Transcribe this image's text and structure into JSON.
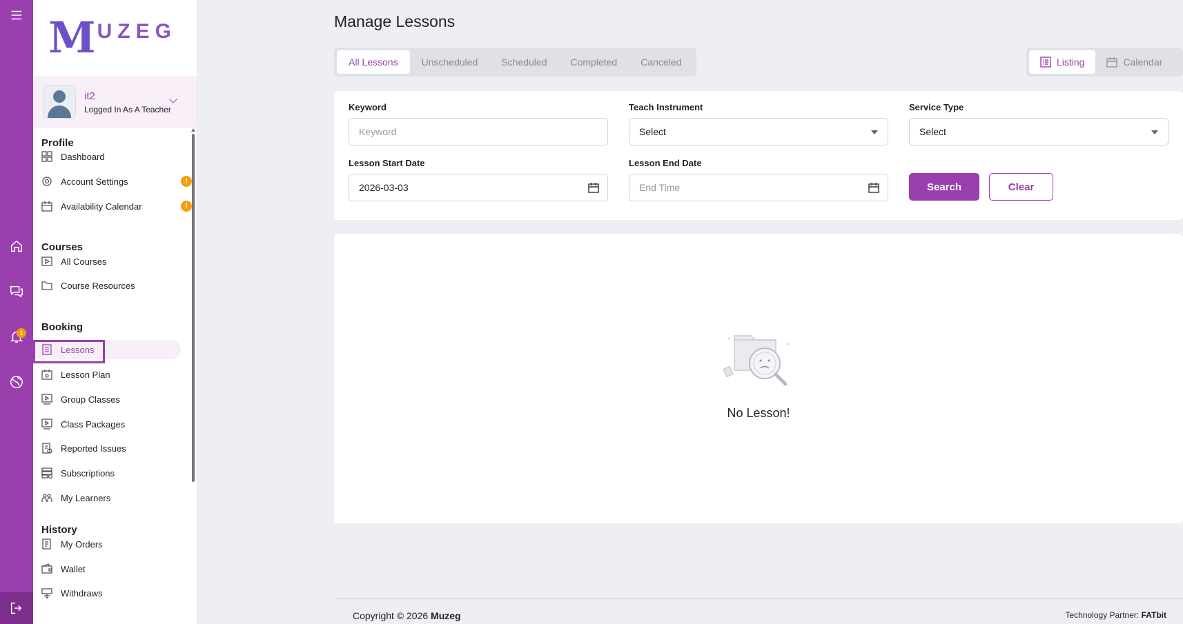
{
  "brand": {
    "mark": "M",
    "word": "UZEG"
  },
  "user": {
    "name": "it2",
    "role": "Logged In As A Teacher"
  },
  "sidebar": {
    "sections": [
      {
        "title": "Profile"
      },
      {
        "title": "Courses"
      },
      {
        "title": "Booking"
      },
      {
        "title": "History"
      }
    ],
    "profile_items": [
      "Dashboard",
      "Account Settings",
      "Availability Calendar"
    ],
    "courses_items": [
      "All Courses",
      "Course Resources"
    ],
    "booking_items": [
      "Lessons",
      "Lesson Plan",
      "Group Classes",
      "Class Packages",
      "Reported Issues",
      "Subscriptions",
      "My Learners"
    ],
    "history_items": [
      "My Orders",
      "Wallet",
      "Withdraws"
    ],
    "warn_badge": "!"
  },
  "rail": {
    "notification_count": "1"
  },
  "page": {
    "title": "Manage Lessons"
  },
  "tabs": [
    "All Lessons",
    "Unscheduled",
    "Scheduled",
    "Completed",
    "Canceled"
  ],
  "view_switch": [
    "Listing",
    "Calendar"
  ],
  "filters": {
    "keyword_label": "Keyword",
    "keyword_placeholder": "Keyword",
    "instrument_label": "Teach Instrument",
    "instrument_value": "Select",
    "service_label": "Service Type",
    "service_value": "Select",
    "start_label": "Lesson Start Date",
    "start_value": "2026-03-03",
    "end_label": "Lesson End Date",
    "end_placeholder": "End Time",
    "search_label": "Search",
    "clear_label": "Clear"
  },
  "results": {
    "empty_text": "No Lesson!"
  },
  "footer": {
    "copyright": "Copyright © 2026",
    "brand": "Muzeg",
    "partner_label": "Technology Partner:",
    "partner": "FATbit"
  },
  "colors": {
    "accent": "#9a3fae",
    "warning": "#f59e0b",
    "background": "#eeeff4"
  }
}
